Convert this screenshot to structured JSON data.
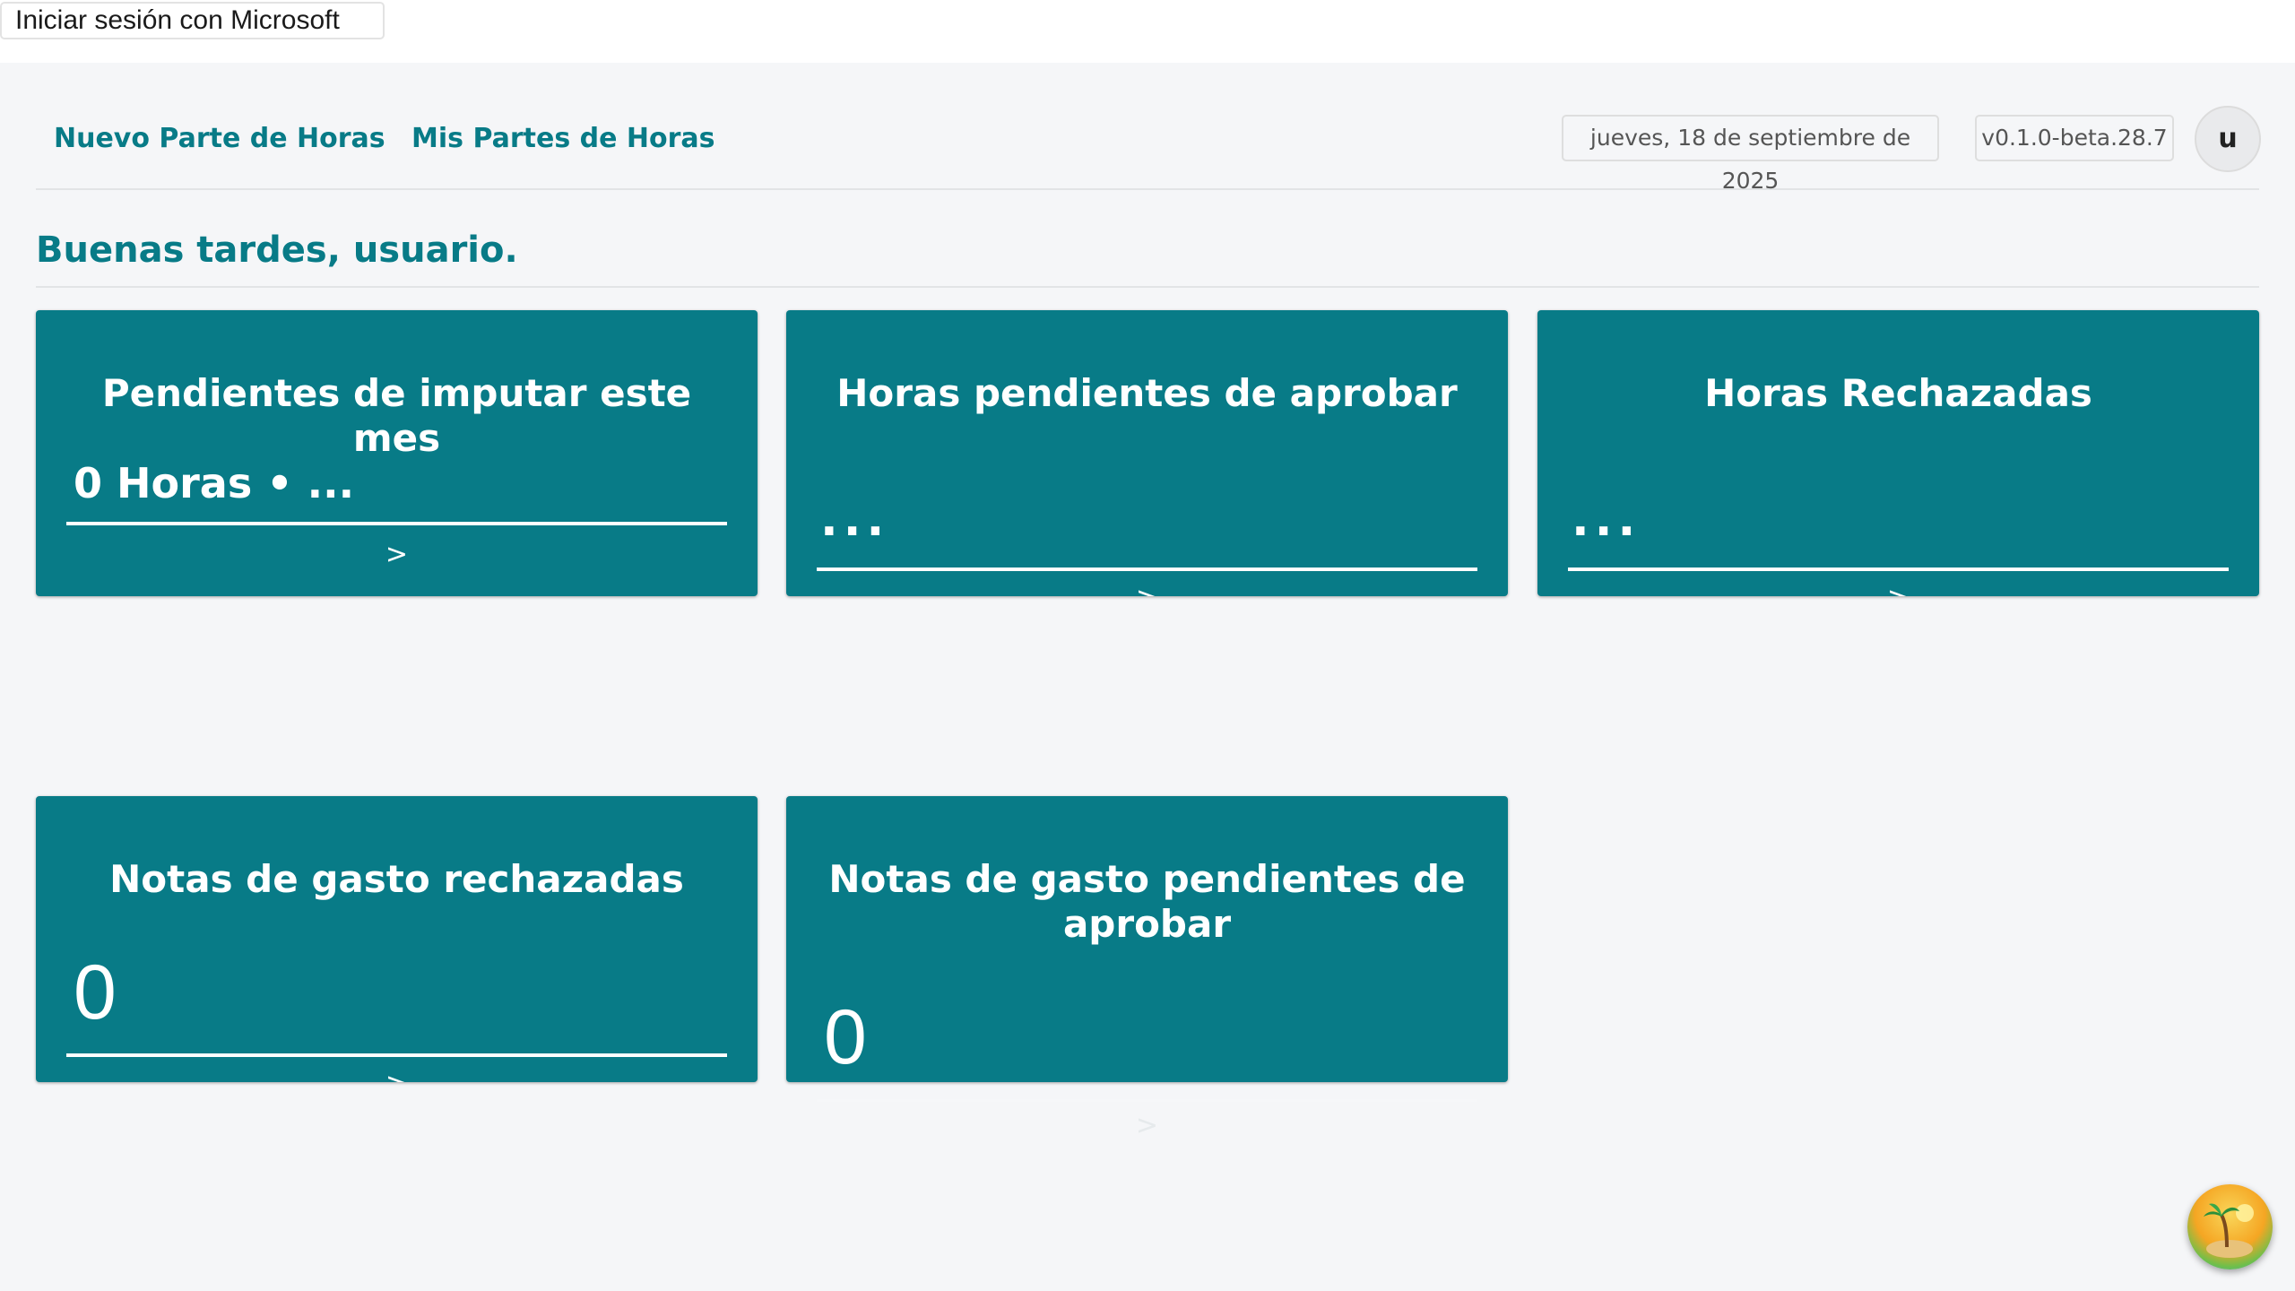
{
  "auth": {
    "login_label": "Iniciar sesión con Microsoft"
  },
  "nav": {
    "new_timesheet": "Nuevo Parte de Horas",
    "my_timesheets": "Mis Partes de Horas",
    "date": "jueves, 18 de septiembre de 2025",
    "version": "v0.1.0-beta.28.7",
    "avatar_initial": "u"
  },
  "greeting": "Buenas tardes, usuario.",
  "cards": [
    {
      "title": "Pendientes de imputar este mes",
      "value": "0 Horas • ...",
      "arrow": ">"
    },
    {
      "title": "Horas pendientes de aprobar",
      "value": "...",
      "arrow": ">"
    },
    {
      "title": "Horas Rechazadas",
      "value": "...",
      "arrow": ">"
    },
    {
      "title": "Notas de gasto rechazadas",
      "value": "0",
      "arrow": ">"
    },
    {
      "title": "Notas de gasto pendientes de aprobar",
      "value": "0",
      "arrow": ">"
    }
  ],
  "colors": {
    "accent": "#087b87",
    "background": "#f5f6f8"
  },
  "icons": {
    "fab": "beach-island-icon"
  }
}
